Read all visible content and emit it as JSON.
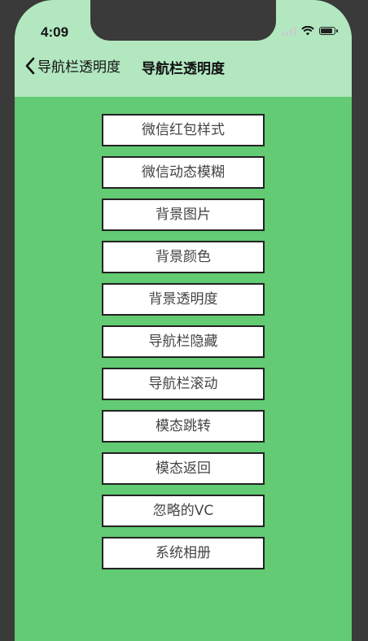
{
  "status_bar": {
    "time": "4:09",
    "icons": [
      "signal-icon",
      "wifi-icon",
      "battery-icon"
    ]
  },
  "navbar": {
    "back_label": "导航栏透明度",
    "title": "导航栏透明度"
  },
  "colors": {
    "background": "#62cb73",
    "navbar_background": "#b2e7c0",
    "button_background": "#ffffff"
  },
  "menu": {
    "items": [
      {
        "label": "微信红包样式"
      },
      {
        "label": "微信动态模糊"
      },
      {
        "label": "背景图片"
      },
      {
        "label": "背景颜色"
      },
      {
        "label": "背景透明度"
      },
      {
        "label": "导航栏隐藏"
      },
      {
        "label": "导航栏滚动"
      },
      {
        "label": "模态跳转"
      },
      {
        "label": "模态返回"
      },
      {
        "label": "忽略的VC"
      },
      {
        "label": "系统相册"
      }
    ]
  }
}
